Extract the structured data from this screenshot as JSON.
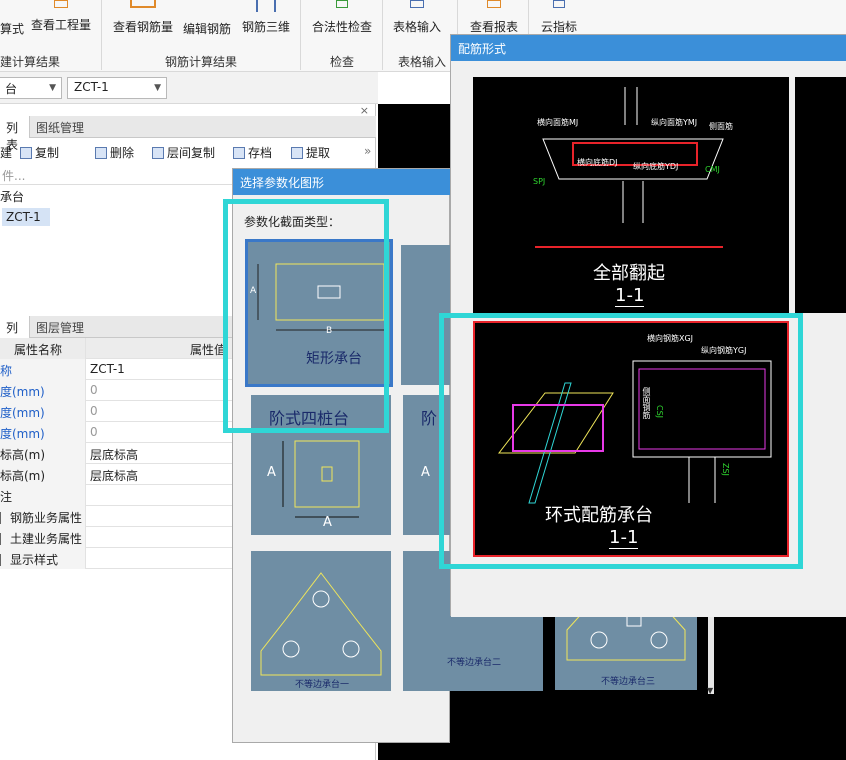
{
  "ribbon": {
    "buttons": [
      "算式",
      "查看工程量",
      "查看钢筋量",
      "编辑钢筋",
      "钢筋三维",
      "合法性检查",
      "表格输入",
      "查看报表",
      "云指标"
    ],
    "groups": [
      "建计算结果",
      "钢筋计算结果",
      "检查",
      "表格输入"
    ]
  },
  "selectors": {
    "floor": "台",
    "component": "ZCT-1"
  },
  "component_panel": {
    "tabs": [
      "列表",
      "图纸管理"
    ],
    "toolbar": [
      "建",
      "复制",
      "删除",
      "层间复制",
      "存档",
      "提取"
    ],
    "search_placeholder": "件...",
    "tree": {
      "group": "承台",
      "item": "ZCT-1"
    }
  },
  "property_panel": {
    "tabs": [
      "列表",
      "图层管理"
    ],
    "header": {
      "name": "属性名称",
      "value": "属性值"
    },
    "rows": [
      {
        "name": "称",
        "value": "ZCT-1"
      },
      {
        "name": "度(mm)",
        "value": "0"
      },
      {
        "name": "度(mm)",
        "value": "0"
      },
      {
        "name": "度(mm)",
        "value": "0"
      },
      {
        "name": "标高(m)",
        "value": "层底标高"
      },
      {
        "name": "标高(m)",
        "value": "层底标高"
      },
      {
        "name": "注",
        "value": ""
      },
      {
        "name": "钢筋业务属性",
        "value": ""
      },
      {
        "name": "土建业务属性",
        "value": ""
      },
      {
        "name": "显示样式",
        "value": ""
      }
    ]
  },
  "param_dialog": {
    "title": "选择参数化图形",
    "section_label": "参数化截面类型：",
    "shapes": [
      "矩形承台",
      "阶式四桩台",
      "阶",
      "不等边承台一",
      "不等边承台二",
      "不等边承台三"
    ],
    "dim_labels": {
      "a": "A",
      "b": "B"
    }
  },
  "rebar_dialog": {
    "title": "配筋形式",
    "options": [
      {
        "name": "全部翻起",
        "section": "1-1",
        "labels": [
          "横向面筋MJ",
          "纵向面筋YMJ",
          "横向底筋DJ",
          "纵向底筋YDJ",
          "CMJ",
          "SPJ",
          "侧面筋"
        ]
      },
      {
        "name": "环式配筋承台",
        "section": "1-1",
        "labels": [
          "横向钢筋XGJ",
          "纵向钢筋YGJ",
          "侧面钢筋",
          "CSJ",
          "ZSJ"
        ]
      }
    ]
  },
  "colors": {
    "highlight": "#2fd6d6",
    "selected_border": "#e8232a",
    "titlebar": "#3b8fd9",
    "thumb_bg": "#6f8ea4"
  }
}
